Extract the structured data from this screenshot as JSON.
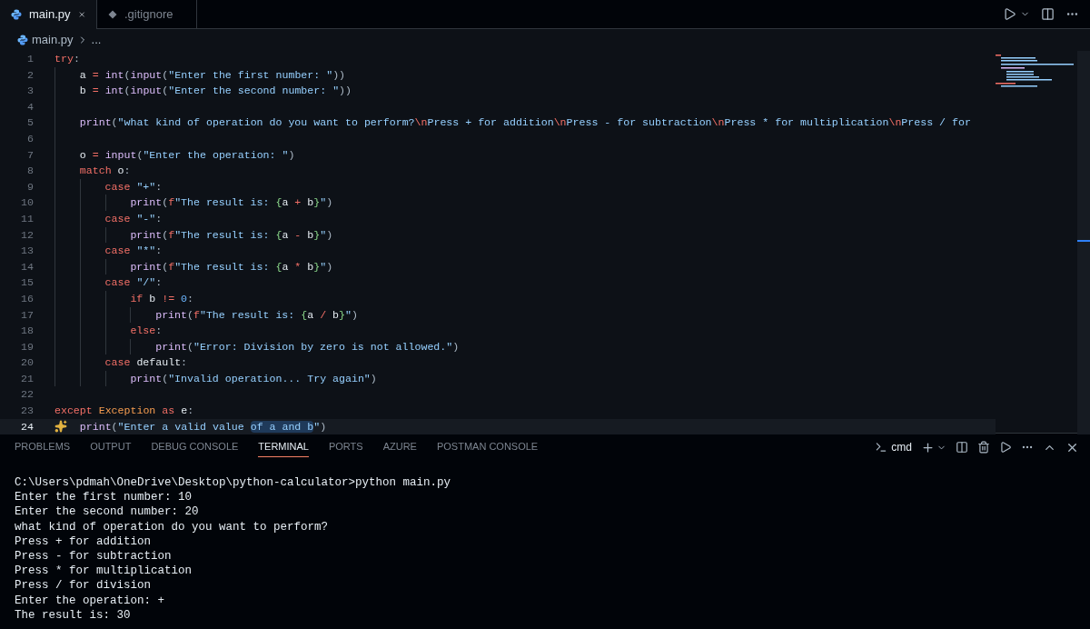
{
  "tabs": [
    {
      "label": "main.py",
      "kind": "python",
      "selected": true
    },
    {
      "label": ".gitignore",
      "kind": "git",
      "selected": false
    }
  ],
  "breadcrumb": {
    "file": "main.py",
    "more": "..."
  },
  "code": [
    {
      "number": "1",
      "current": false,
      "tokens": [
        {
          "text": "try",
          "kind": "kw"
        },
        {
          "text": ":",
          "kind": "punct"
        }
      ],
      "children": [
        {
          "number": "2",
          "current": false,
          "tokens": [
            {
              "text": "a",
              "kind": "var"
            },
            {
              "text": " = ",
              "kind": "op"
            },
            {
              "text": "int",
              "kind": "fn"
            },
            {
              "text": "(",
              "kind": "punct"
            },
            {
              "text": "input",
              "kind": "fn"
            },
            {
              "text": "(",
              "kind": "punct"
            },
            {
              "text": "\"Enter the first number: \"",
              "kind": "str"
            },
            {
              "text": "))",
              "kind": "punct"
            }
          ]
        },
        {
          "number": "3",
          "current": false,
          "tokens": [
            {
              "text": "b",
              "kind": "var"
            },
            {
              "text": " = ",
              "kind": "op"
            },
            {
              "text": "int",
              "kind": "fn"
            },
            {
              "text": "(",
              "kind": "punct"
            },
            {
              "text": "input",
              "kind": "fn"
            },
            {
              "text": "(",
              "kind": "punct"
            },
            {
              "text": "\"Enter the second number: \"",
              "kind": "str"
            },
            {
              "text": "))",
              "kind": "punct"
            }
          ]
        },
        {
          "number": "4",
          "current": false
        },
        {
          "number": "5",
          "current": false,
          "tokens": [
            {
              "text": "print",
              "kind": "fn"
            },
            {
              "text": "(",
              "kind": "punct"
            },
            {
              "text": "\"what kind of operation do you want to perform?",
              "kind": "str"
            },
            {
              "text": "\\n",
              "kind": "esc"
            },
            {
              "text": "Press + for addition",
              "kind": "str"
            },
            {
              "text": "\\n",
              "kind": "esc"
            },
            {
              "text": "Press - for subtraction",
              "kind": "str"
            },
            {
              "text": "\\n",
              "kind": "esc"
            },
            {
              "text": "Press * for multiplication",
              "kind": "str"
            },
            {
              "text": "\\n",
              "kind": "esc"
            },
            {
              "text": "Press / for",
              "kind": "str"
            }
          ]
        },
        {
          "number": "6",
          "current": false
        },
        {
          "number": "7",
          "current": false,
          "tokens": [
            {
              "text": "o",
              "kind": "var"
            },
            {
              "text": " = ",
              "kind": "op"
            },
            {
              "text": "input",
              "kind": "fn"
            },
            {
              "text": "(",
              "kind": "punct"
            },
            {
              "text": "\"Enter the operation: \"",
              "kind": "str"
            },
            {
              "text": ")",
              "kind": "punct"
            }
          ]
        },
        {
          "number": "8",
          "current": false,
          "tokens": [
            {
              "text": "match",
              "kind": "kw"
            },
            {
              "text": " o",
              "kind": "var"
            },
            {
              "text": ":",
              "kind": "punct"
            }
          ],
          "children": [
            {
              "number": "9",
              "current": false,
              "tokens": [
                {
                  "text": "case",
                  "kind": "kw"
                },
                {
                  "text": " \"+\"",
                  "kind": "str"
                },
                {
                  "text": ":",
                  "kind": "punct"
                }
              ],
              "children": [
                {
                  "number": "10",
                  "current": false,
                  "tokens": [
                    {
                      "text": "print",
                      "kind": "fn"
                    },
                    {
                      "text": "(",
                      "kind": "punct"
                    },
                    {
                      "text": "f",
                      "kind": "kw"
                    },
                    {
                      "text": "\"The result is: ",
                      "kind": "str"
                    },
                    {
                      "text": "{",
                      "kind": "brace"
                    },
                    {
                      "text": "a",
                      "kind": "var"
                    },
                    {
                      "text": " + ",
                      "kind": "op"
                    },
                    {
                      "text": "b",
                      "kind": "var"
                    },
                    {
                      "text": "}",
                      "kind": "brace"
                    },
                    {
                      "text": "\"",
                      "kind": "str"
                    },
                    {
                      "text": ")",
                      "kind": "punct"
                    }
                  ]
                }
              ]
            },
            {
              "number": "11",
              "current": false,
              "tokens": [
                {
                  "text": "case",
                  "kind": "kw"
                },
                {
                  "text": " \"-\"",
                  "kind": "str"
                },
                {
                  "text": ":",
                  "kind": "punct"
                }
              ],
              "children": [
                {
                  "number": "12",
                  "current": false,
                  "tokens": [
                    {
                      "text": "print",
                      "kind": "fn"
                    },
                    {
                      "text": "(",
                      "kind": "punct"
                    },
                    {
                      "text": "f",
                      "kind": "kw"
                    },
                    {
                      "text": "\"The result is: ",
                      "kind": "str"
                    },
                    {
                      "text": "{",
                      "kind": "brace"
                    },
                    {
                      "text": "a",
                      "kind": "var"
                    },
                    {
                      "text": " - ",
                      "kind": "op"
                    },
                    {
                      "text": "b",
                      "kind": "var"
                    },
                    {
                      "text": "}",
                      "kind": "brace"
                    },
                    {
                      "text": "\"",
                      "kind": "str"
                    },
                    {
                      "text": ")",
                      "kind": "punct"
                    }
                  ]
                }
              ]
            },
            {
              "number": "13",
              "current": false,
              "tokens": [
                {
                  "text": "case",
                  "kind": "kw"
                },
                {
                  "text": " \"*\"",
                  "kind": "str"
                },
                {
                  "text": ":",
                  "kind": "punct"
                }
              ],
              "children": [
                {
                  "number": "14",
                  "current": false,
                  "tokens": [
                    {
                      "text": "print",
                      "kind": "fn"
                    },
                    {
                      "text": "(",
                      "kind": "punct"
                    },
                    {
                      "text": "f",
                      "kind": "kw"
                    },
                    {
                      "text": "\"The result is: ",
                      "kind": "str"
                    },
                    {
                      "text": "{",
                      "kind": "brace"
                    },
                    {
                      "text": "a",
                      "kind": "var"
                    },
                    {
                      "text": " * ",
                      "kind": "op"
                    },
                    {
                      "text": "b",
                      "kind": "var"
                    },
                    {
                      "text": "}",
                      "kind": "brace"
                    },
                    {
                      "text": "\"",
                      "kind": "str"
                    },
                    {
                      "text": ")",
                      "kind": "punct"
                    }
                  ]
                }
              ]
            },
            {
              "number": "15",
              "current": false,
              "tokens": [
                {
                  "text": "case",
                  "kind": "kw"
                },
                {
                  "text": " \"/\"",
                  "kind": "str"
                },
                {
                  "text": ":",
                  "kind": "punct"
                }
              ],
              "children": [
                {
                  "number": "16",
                  "current": false,
                  "tokens": [
                    {
                      "text": "if",
                      "kind": "kw"
                    },
                    {
                      "text": " b",
                      "kind": "var"
                    },
                    {
                      "text": " != ",
                      "kind": "op"
                    },
                    {
                      "text": "0",
                      "kind": "num"
                    },
                    {
                      "text": ":",
                      "kind": "punct"
                    }
                  ],
                  "children": [
                    {
                      "number": "17",
                      "current": false,
                      "tokens": [
                        {
                          "text": "print",
                          "kind": "fn"
                        },
                        {
                          "text": "(",
                          "kind": "punct"
                        },
                        {
                          "text": "f",
                          "kind": "kw"
                        },
                        {
                          "text": "\"The result is: ",
                          "kind": "str"
                        },
                        {
                          "text": "{",
                          "kind": "brace"
                        },
                        {
                          "text": "a",
                          "kind": "var"
                        },
                        {
                          "text": " / ",
                          "kind": "op"
                        },
                        {
                          "text": "b",
                          "kind": "var"
                        },
                        {
                          "text": "}",
                          "kind": "brace"
                        },
                        {
                          "text": "\"",
                          "kind": "str"
                        },
                        {
                          "text": ")",
                          "kind": "punct"
                        }
                      ]
                    }
                  ]
                },
                {
                  "number": "18",
                  "current": false,
                  "tokens": [
                    {
                      "text": "else",
                      "kind": "kw"
                    },
                    {
                      "text": ":",
                      "kind": "punct"
                    }
                  ],
                  "children": [
                    {
                      "number": "19",
                      "current": false,
                      "tokens": [
                        {
                          "text": "print",
                          "kind": "fn"
                        },
                        {
                          "text": "(",
                          "kind": "punct"
                        },
                        {
                          "text": "\"Error: Division by zero is not allowed.\"",
                          "kind": "str"
                        },
                        {
                          "text": ")",
                          "kind": "punct"
                        }
                      ]
                    }
                  ]
                }
              ]
            },
            {
              "number": "20",
              "current": false,
              "tokens": [
                {
                  "text": "case",
                  "kind": "kw"
                },
                {
                  "text": " default",
                  "kind": "var"
                },
                {
                  "text": ":",
                  "kind": "punct"
                }
              ],
              "children": [
                {
                  "number": "21",
                  "current": false,
                  "tokens": [
                    {
                      "text": "print",
                      "kind": "fn"
                    },
                    {
                      "text": "(",
                      "kind": "punct"
                    },
                    {
                      "text": "\"Invalid operation... Try again\"",
                      "kind": "str"
                    },
                    {
                      "text": ")",
                      "kind": "punct"
                    }
                  ]
                }
              ]
            }
          ]
        }
      ]
    },
    {
      "number": "22",
      "current": false
    },
    {
      "number": "23",
      "current": false,
      "tokens": [
        {
          "text": "except",
          "kind": "kw"
        },
        {
          "text": " Exception",
          "kind": "cls"
        },
        {
          "text": " as",
          "kind": "kw"
        },
        {
          "text": " e",
          "kind": "var"
        },
        {
          "text": ":",
          "kind": "punct"
        }
      ],
      "children": [
        {
          "number": "24",
          "current": true,
          "tokens": [
            {
              "text": "print",
              "kind": "fn"
            },
            {
              "text": "(",
              "kind": "punct"
            },
            {
              "text": "\"Enter a valid value ",
              "kind": "str"
            },
            {
              "text": "of a and b",
              "kind": "str",
              "highlighted": true
            },
            {
              "text": "\"",
              "kind": "str"
            },
            {
              "text": ")",
              "kind": "punct"
            }
          ]
        }
      ]
    }
  ],
  "panel": {
    "tabs": [
      {
        "label": "PROBLEMS",
        "selected": false
      },
      {
        "label": "OUTPUT",
        "selected": false
      },
      {
        "label": "DEBUG CONSOLE",
        "selected": false
      },
      {
        "label": "TERMINAL",
        "selected": true
      },
      {
        "label": "PORTS",
        "selected": false
      },
      {
        "label": "AZURE",
        "selected": false
      },
      {
        "label": "POSTMAN CONSOLE",
        "selected": false
      }
    ],
    "shell": "cmd",
    "terminal": [
      "C:\\Users\\pdmah\\OneDrive\\Desktop\\python-calculator>python main.py",
      "Enter the first number: 10",
      "Enter the second number: 20",
      "what kind of operation do you want to perform?",
      "Press + for addition",
      "Press - for subtraction",
      "Press * for multiplication",
      "Press / for division",
      "Enter the operation: +",
      "The result is: 30"
    ]
  }
}
